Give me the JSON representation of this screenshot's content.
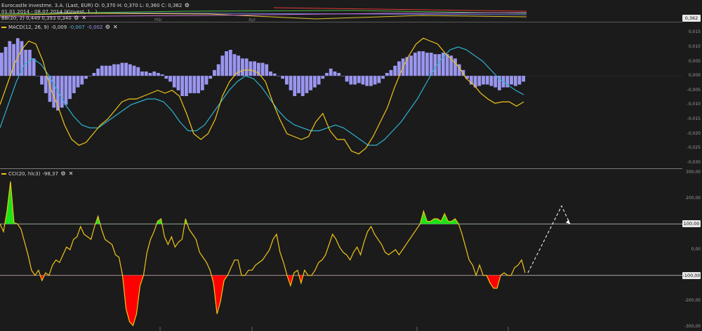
{
  "price_header": {
    "line1": "Eurocastle Investme. 3.A. (Last, EUR)  O: 0,370  H: 0,370  L: 0,360  C: 0,362",
    "line2": "01.01.2014 - 08.07.2014 (Kinvest, 1...)",
    "line3": "BB(20, 2)  0,449  0,393  0,340",
    "last_price": "0,362",
    "month_labels": [
      "Mär",
      "Apr"
    ]
  },
  "macd_header": {
    "name": "MACD(12, 26, 9)",
    "macd": "-0,009",
    "signal": "-0,007",
    "hist": "-0,002"
  },
  "cci_header": {
    "name": "CCI(20, hlc3)",
    "value": "-98,37"
  },
  "colors": {
    "background": "#1b1b1b",
    "macd_line": "#f0c419",
    "signal_line": "#2fb1d0",
    "histogram": "#9a96ee",
    "cci_line": "#f0c419",
    "cci_overbought_fill": "#19e319",
    "cci_oversold_fill": "#ff0000"
  },
  "icons": [
    "settings-icon",
    "close-icon"
  ],
  "chart_data": [
    {
      "type": "bar",
      "title": "MACD(12, 26, 9)",
      "ylim": [
        -0.031,
        0.017
      ],
      "y_ticks": [
        0.015,
        0.01,
        0.005,
        0.0,
        -0.005,
        -0.01,
        -0.015,
        -0.02,
        -0.025,
        -0.03
      ],
      "y_tick_labels": [
        "0,015",
        "0,010",
        "0,005",
        "0,000",
        "-0,005",
        "-0,010",
        "-0,015",
        "-0,020",
        "-0,025",
        "-0,030"
      ],
      "grid": false,
      "series": [
        {
          "name": "hist",
          "values": [
            0.008,
            0.01,
            0.012,
            0.011,
            0.013,
            0.012,
            0.009,
            0.009,
            0.006,
            0.0,
            -0.003,
            -0.006,
            -0.009,
            -0.011,
            -0.012,
            -0.011,
            -0.01,
            -0.008,
            -0.006,
            -0.004,
            -0.003,
            -0.001,
            0.0,
            0.001,
            0.0025,
            0.0035,
            0.0035,
            0.0035,
            0.004,
            0.004,
            0.0045,
            0.0045,
            0.004,
            0.0035,
            0.003,
            0.0015,
            0.0015,
            0.001,
            0.0015,
            0.001,
            0.0005,
            -0.001,
            -0.002,
            -0.004,
            -0.005,
            -0.007,
            -0.007,
            -0.006,
            -0.006,
            -0.006,
            -0.005,
            -0.003,
            -0.001,
            0.002,
            0.004,
            0.007,
            0.0085,
            0.009,
            0.0075,
            0.007,
            0.006,
            0.006,
            0.005,
            0.005,
            0.0045,
            0.0045,
            0.004,
            0.0015,
            0.0008,
            0.0,
            -0.001,
            -0.003,
            -0.005,
            -0.007,
            -0.006,
            -0.007,
            -0.006,
            -0.005,
            -0.004,
            -0.003,
            -0.001,
            0.001,
            0.0025,
            0.0015,
            0.001,
            0.0,
            -0.002,
            -0.003,
            -0.003,
            -0.0025,
            -0.003,
            -0.0035,
            -0.0035,
            -0.003,
            -0.0025,
            -0.001,
            0.001,
            0.002,
            0.0035,
            0.005,
            0.006,
            0.0065,
            0.007,
            0.008,
            0.0085,
            0.0085,
            0.008,
            0.008,
            0.0075,
            0.0075,
            0.008,
            0.0075,
            0.007,
            0.006,
            0.004,
            0.002,
            -0.001,
            -0.003,
            -0.004,
            -0.0035,
            -0.003,
            -0.003,
            -0.0035,
            -0.004,
            -0.005,
            -0.004,
            -0.004,
            -0.003,
            -0.0035,
            -0.003,
            -0.002
          ]
        },
        {
          "name": "MACD",
          "values": [
            -0.01,
            -0.003,
            0.004,
            0.009,
            0.012,
            0.011,
            0.005,
            -0.004,
            -0.01,
            -0.017,
            -0.022,
            -0.024,
            -0.023,
            -0.02,
            -0.017,
            -0.015,
            -0.012,
            -0.009,
            -0.008,
            -0.008,
            -0.007,
            -0.006,
            -0.005,
            -0.006,
            -0.005,
            -0.007,
            -0.013,
            -0.02,
            -0.022,
            -0.02,
            -0.015,
            -0.007,
            -0.002,
            0.001,
            0.002,
            0.002,
            0.001,
            -0.002,
            -0.009,
            -0.015,
            -0.02,
            -0.021,
            -0.022,
            -0.021,
            -0.016,
            -0.013,
            -0.019,
            -0.022,
            -0.022,
            -0.026,
            -0.027,
            -0.025,
            -0.021,
            -0.016,
            -0.011,
            -0.004,
            0.002,
            0.007,
            0.011,
            0.013,
            0.012,
            0.011,
            0.008,
            0.0055,
            0.003,
            -0.001,
            -0.003,
            -0.006,
            -0.008,
            -0.0095,
            -0.009,
            -0.009,
            -0.0105,
            -0.009
          ]
        },
        {
          "name": "Signal",
          "values": [
            -0.018,
            -0.01,
            -0.002,
            0.004,
            0.006,
            0.004,
            0.0,
            -0.005,
            -0.01,
            -0.014,
            -0.017,
            -0.018,
            -0.018,
            -0.016,
            -0.014,
            -0.012,
            -0.01,
            -0.009,
            -0.008,
            -0.008,
            -0.009,
            -0.012,
            -0.016,
            -0.019,
            -0.019,
            -0.017,
            -0.013,
            -0.009,
            -0.005,
            -0.002,
            0.0,
            -0.001,
            -0.004,
            -0.008,
            -0.012,
            -0.015,
            -0.017,
            -0.018,
            -0.019,
            -0.019,
            -0.018,
            -0.017,
            -0.018,
            -0.02,
            -0.022,
            -0.024,
            -0.024,
            -0.022,
            -0.019,
            -0.016,
            -0.012,
            -0.008,
            -0.003,
            0.002,
            0.006,
            0.009,
            0.01,
            0.009,
            0.007,
            0.005,
            0.002,
            -0.001,
            -0.003,
            -0.005,
            -0.0065
          ]
        }
      ]
    },
    {
      "type": "line",
      "title": "CCI(20, hlc3)",
      "ylim": [
        -300,
        300
      ],
      "y_ticks": [
        300,
        200,
        100,
        0,
        -100,
        -200,
        -300
      ],
      "y_tick_labels": [
        "300,00",
        "200,00",
        "100,00",
        "0,00",
        "-100,00",
        "-200,00",
        "-300,00"
      ],
      "highlighted_levels": [
        100,
        -100
      ],
      "grid": false,
      "series": [
        {
          "name": "CCI",
          "values": [
            100,
            70,
            150,
            265,
            105,
            100,
            80,
            30,
            -20,
            -80,
            -100,
            -80,
            -120,
            -90,
            -100,
            -60,
            -40,
            -50,
            -20,
            10,
            0,
            40,
            50,
            90,
            60,
            50,
            40,
            90,
            130,
            80,
            40,
            30,
            20,
            -20,
            -30,
            -100,
            -230,
            -280,
            -295,
            -250,
            -140,
            -100,
            -10,
            40,
            70,
            110,
            120,
            50,
            20,
            50,
            10,
            30,
            40,
            120,
            80,
            60,
            40,
            -10,
            -30,
            -50,
            -80,
            -130,
            -250,
            -200,
            -120,
            -100,
            -70,
            -40,
            -40,
            -100,
            -100,
            -80,
            -80,
            -60,
            -50,
            -40,
            -20,
            0,
            40,
            60,
            -10,
            -50,
            -100,
            -140,
            -90,
            -80,
            -130,
            -80,
            -100,
            -100,
            -80,
            -50,
            -40,
            -20,
            20,
            60,
            40,
            10,
            -10,
            -20,
            -40,
            -10,
            10,
            -20,
            30,
            70,
            90,
            60,
            40,
            20,
            -10,
            -20,
            -10,
            0,
            -20,
            0,
            20,
            40,
            60,
            80,
            100,
            150,
            110,
            110,
            120,
            120,
            110,
            140,
            110,
            110,
            120,
            100,
            60,
            10,
            -40,
            -60,
            -100,
            -60,
            -100,
            -100,
            -130,
            -150,
            -150,
            -100,
            -90,
            -100,
            -100,
            -70,
            -60,
            -40,
            -90
          ]
        },
        {
          "name": "projection",
          "values": [
            -90,
            170,
            100
          ]
        }
      ]
    }
  ]
}
